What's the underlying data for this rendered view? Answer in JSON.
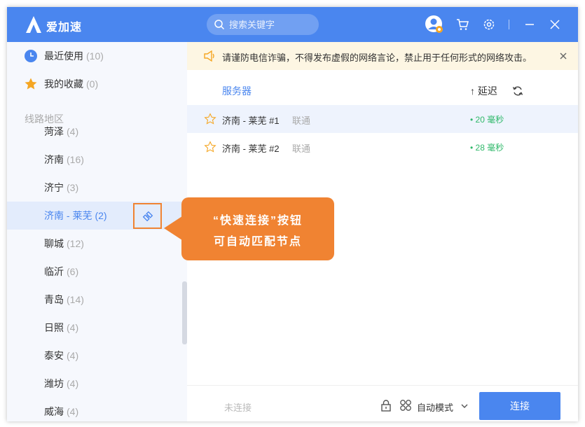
{
  "app": {
    "name": "爱加速"
  },
  "search": {
    "placeholder": "搜索关键字"
  },
  "sidebar": {
    "recent": {
      "label": "最近使用",
      "count": "(10)"
    },
    "favorites": {
      "label": "我的收藏",
      "count": "(0)"
    },
    "section_title": "线路地区",
    "regions": [
      {
        "label": "菏泽",
        "count": "(4)"
      },
      {
        "label": "济南",
        "count": "(16)"
      },
      {
        "label": "济宁",
        "count": "(3)"
      },
      {
        "label": "济南 - 莱芜",
        "count": "(2)"
      },
      {
        "label": "聊城",
        "count": "(12)"
      },
      {
        "label": "临沂",
        "count": "(6)"
      },
      {
        "label": "青岛",
        "count": "(14)"
      },
      {
        "label": "日照",
        "count": "(4)"
      },
      {
        "label": "泰安",
        "count": "(4)"
      },
      {
        "label": "潍坊",
        "count": "(4)"
      },
      {
        "label": "威海",
        "count": "(4)"
      }
    ]
  },
  "callout": {
    "line1": "“快速连接”按钮",
    "line2": "可自动匹配节点"
  },
  "notice": {
    "text": "请谨防电信诈骗，不得发布虚假的网络言论，禁止用于任何形式的网络攻击。"
  },
  "table": {
    "col_server": "服务器",
    "col_latency": "↑ 延迟",
    "rows": [
      {
        "name": "济南 - 莱芜 #1",
        "isp": "联通",
        "latency": "• 20 毫秒"
      },
      {
        "name": "济南 - 莱芜 #2",
        "isp": "联通",
        "latency": "• 28 毫秒"
      }
    ]
  },
  "footer": {
    "status": "未连接",
    "mode": "自动模式",
    "connect_label": "连接"
  },
  "colors": {
    "accent": "#4a86ef",
    "callout": "#f08332",
    "latency_good": "#2fb86a"
  }
}
